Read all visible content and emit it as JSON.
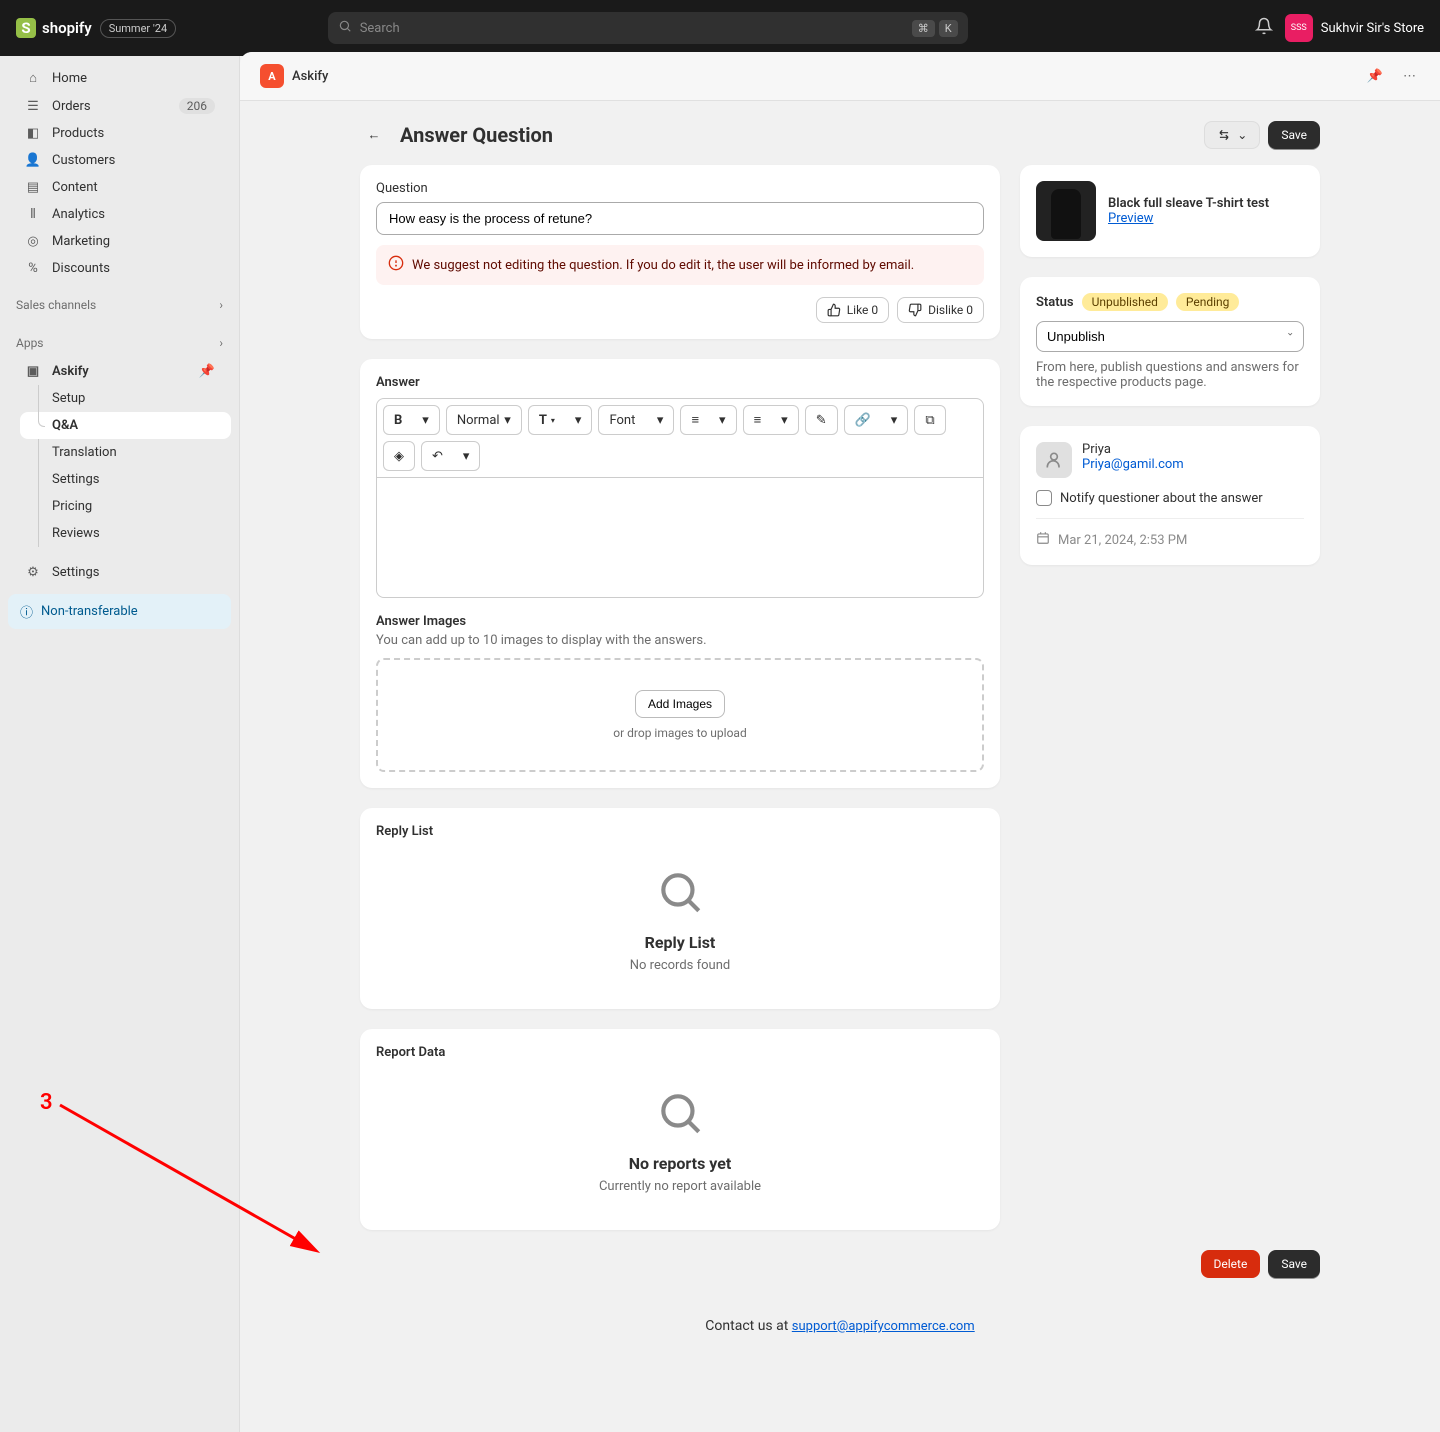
{
  "topbar": {
    "brand": "shopify",
    "badge": "Summer '24",
    "search_placeholder": "Search",
    "kbd1": "⌘",
    "kbd2": "K",
    "store_initials": "SSS",
    "store_name": "Sukhvir Sir's Store"
  },
  "sidebar": {
    "home": "Home",
    "orders": "Orders",
    "orders_count": "206",
    "products": "Products",
    "customers": "Customers",
    "content": "Content",
    "analytics": "Analytics",
    "marketing": "Marketing",
    "discounts": "Discounts",
    "sales_channels": "Sales channels",
    "apps": "Apps",
    "askify": "Askify",
    "setup": "Setup",
    "qa": "Q&A",
    "translation": "Translation",
    "app_settings": "Settings",
    "pricing": "Pricing",
    "reviews": "Reviews",
    "settings": "Settings",
    "non_transferable": "Non-transferable"
  },
  "app_header": {
    "title": "Askify"
  },
  "page": {
    "title": "Answer Question",
    "lang_btn": "⇄",
    "save": "Save"
  },
  "question_card": {
    "label": "Question",
    "value": "How easy is the process of retune?",
    "alert": "We suggest not editing the question. If you do edit it, the user will be informed by email.",
    "like": "Like 0",
    "dislike": "Dislike 0"
  },
  "answer_card": {
    "label": "Answer",
    "format_normal": "Normal",
    "format_font": "Font",
    "images_label": "Answer Images",
    "images_help": "You can add up to 10 images to display with the answers.",
    "add_images": "Add Images",
    "drop_hint": "or drop images to upload"
  },
  "reply_card": {
    "heading": "Reply List",
    "empty_title": "Reply List",
    "empty_sub": "No records found"
  },
  "report_card": {
    "heading": "Report Data",
    "empty_title": "No reports yet",
    "empty_sub": "Currently no report available"
  },
  "product": {
    "title": "Black full sleave T-shirt test",
    "preview": "Preview"
  },
  "status": {
    "label": "Status",
    "tag1": "Unpublished",
    "tag2": "Pending",
    "select": "Unpublish",
    "help": "From here, publish questions and answers for the respective products page."
  },
  "user": {
    "name": "Priya",
    "email": "Priya@gamil.com",
    "notify": "Notify questioner about the answer",
    "date": "Mar 21, 2024, 2:53 PM"
  },
  "bottom": {
    "delete": "Delete",
    "save": "Save"
  },
  "footer": {
    "text": "Contact us at ",
    "link": "support@appifycommerce.com"
  },
  "annotation": {
    "num": "3"
  }
}
